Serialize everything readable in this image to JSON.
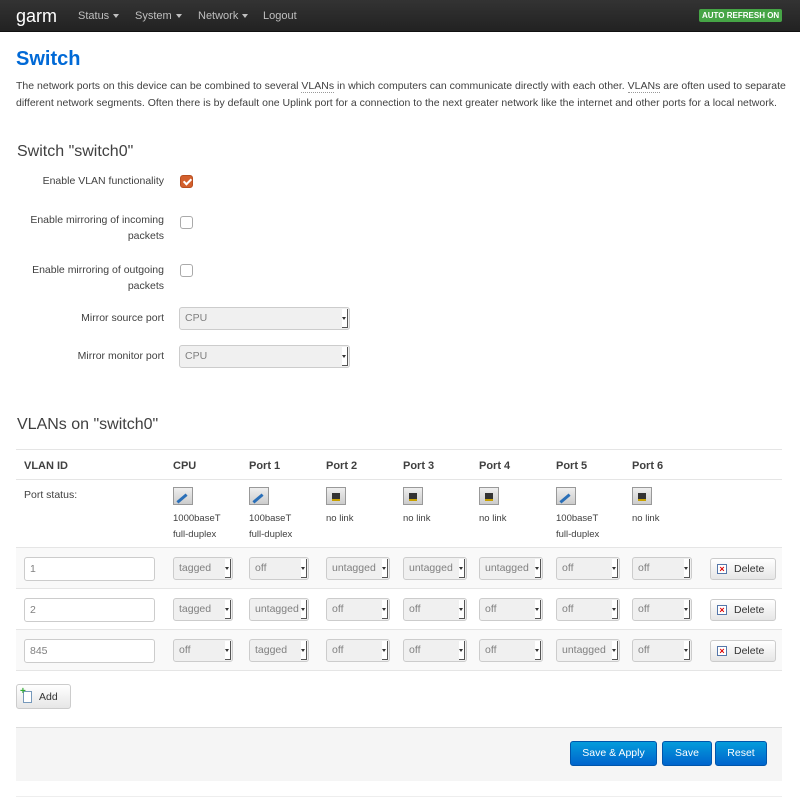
{
  "navbar": {
    "brand": "garm",
    "menu": [
      {
        "label": "Status",
        "dropdown": true
      },
      {
        "label": "System",
        "dropdown": true
      },
      {
        "label": "Network",
        "dropdown": true
      },
      {
        "label": "Logout",
        "dropdown": false
      }
    ],
    "refresh_badge": "AUTO REFRESH ON"
  },
  "page": {
    "title": "Switch",
    "description": {
      "part1": "The network ports on this device can be combined to several ",
      "abbr1": "VLANs",
      "part2": " in which computers can communicate directly with each other. ",
      "abbr2": "VLANs",
      "part3": " are often used to separate different network segments. Often there is by default one Uplink port for a connection to the next greater network like the internet and other ports for a local network."
    }
  },
  "switch_section": {
    "title": "Switch \"switch0\"",
    "enable_vlan": {
      "label": "Enable VLAN functionality",
      "checked": true
    },
    "mirror_in": {
      "label": "Enable mirroring of incoming packets",
      "checked": false
    },
    "mirror_out": {
      "label": "Enable mirroring of outgoing packets",
      "checked": false
    },
    "mirror_source": {
      "label": "Mirror source port",
      "value": "CPU"
    },
    "mirror_monitor": {
      "label": "Mirror monitor port",
      "value": "CPU"
    }
  },
  "vlan_section": {
    "title": "VLANs on \"switch0\"",
    "headers": [
      "VLAN ID",
      "CPU",
      "Port 1",
      "Port 2",
      "Port 3",
      "Port 4",
      "Port 5",
      "Port 6"
    ],
    "port_status_label": "Port status:",
    "port_status": [
      {
        "link": true,
        "line1": "1000baseT",
        "line2": "full-duplex"
      },
      {
        "link": true,
        "line1": "100baseT",
        "line2": "full-duplex"
      },
      {
        "link": false,
        "line1": "no link",
        "line2": ""
      },
      {
        "link": false,
        "line1": "no link",
        "line2": ""
      },
      {
        "link": false,
        "line1": "no link",
        "line2": ""
      },
      {
        "link": true,
        "line1": "100baseT",
        "line2": "full-duplex"
      },
      {
        "link": false,
        "line1": "no link",
        "line2": ""
      }
    ],
    "rows": [
      {
        "vlan_id": "1",
        "ports": [
          "tagged",
          "off",
          "untagged",
          "untagged",
          "untagged",
          "off",
          "off"
        ]
      },
      {
        "vlan_id": "2",
        "ports": [
          "tagged",
          "untagged",
          "off",
          "off",
          "off",
          "off",
          "off"
        ]
      },
      {
        "vlan_id": "845",
        "ports": [
          "off",
          "tagged",
          "off",
          "off",
          "off",
          "untagged",
          "off"
        ]
      }
    ],
    "delete_label": "Delete",
    "add_label": "Add"
  },
  "actions": {
    "save_apply": "Save & Apply",
    "save": "Save",
    "reset": "Reset"
  }
}
